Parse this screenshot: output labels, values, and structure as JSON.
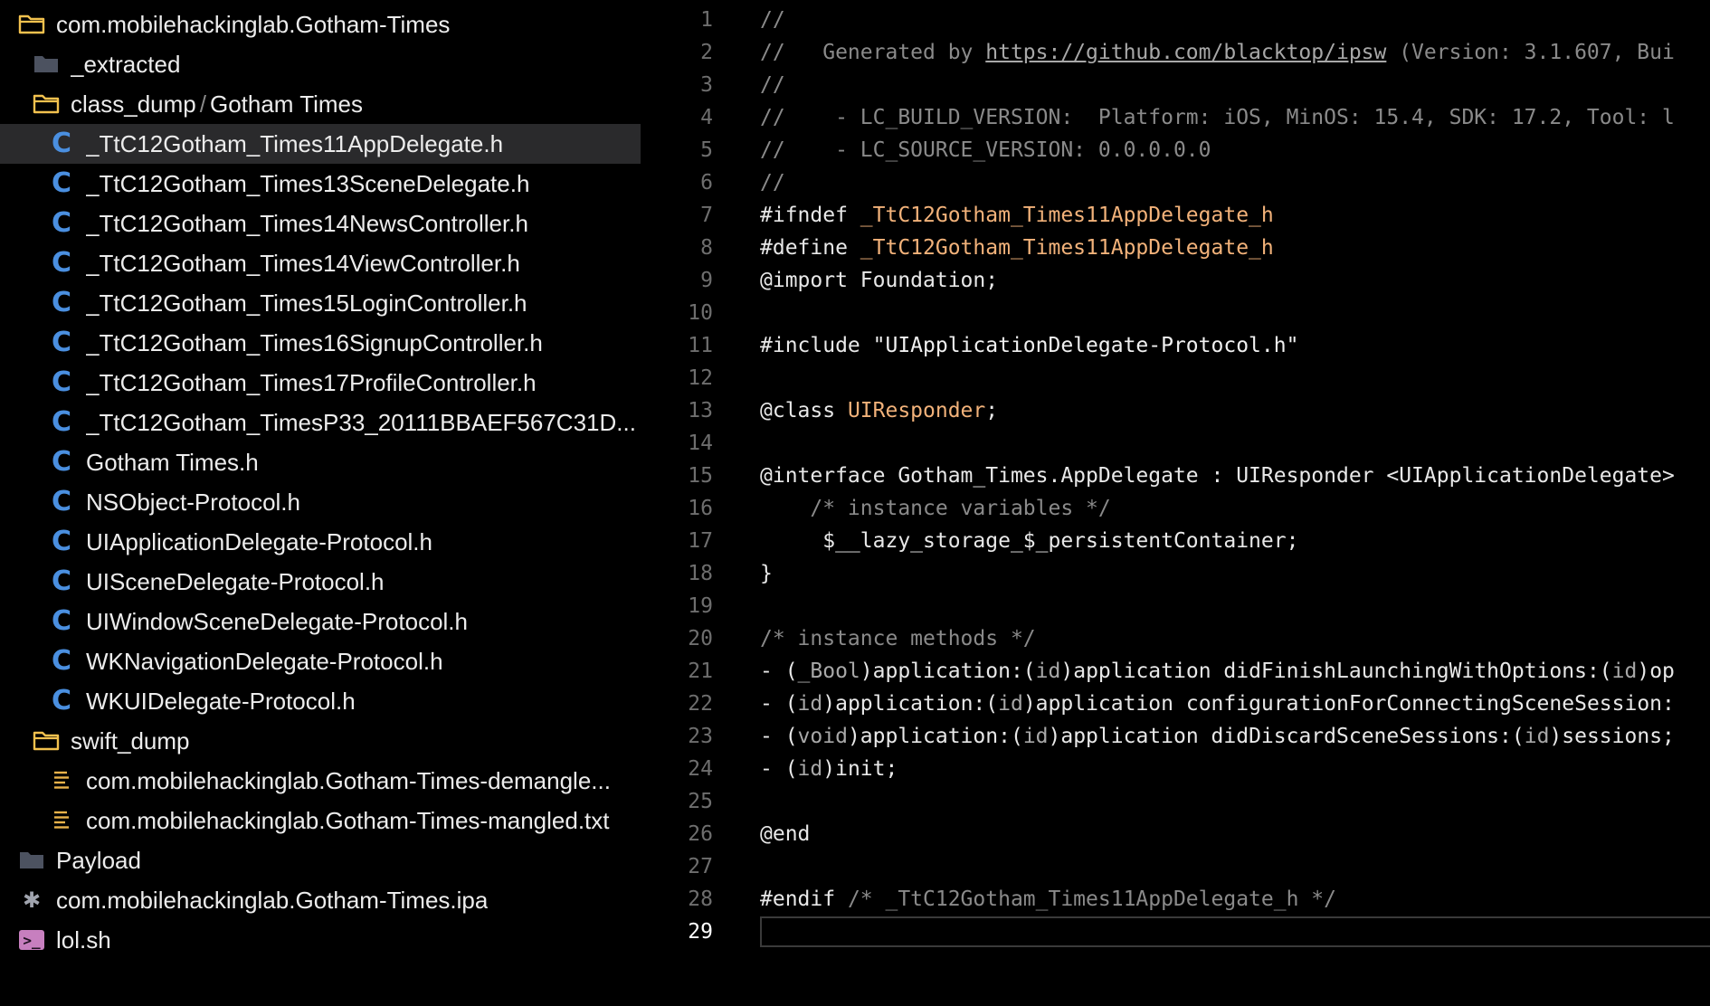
{
  "sidebar": {
    "items": [
      {
        "label": "com.mobilehackinglab.Gotham-Times",
        "icon": "folder-open-icon",
        "depth": 0
      },
      {
        "label": "_extracted",
        "icon": "folder-icon",
        "depth": 1
      },
      {
        "label": "class_dump",
        "label2": "Gotham Times",
        "sep": "/",
        "icon": "folder-open-icon",
        "depth": 1
      },
      {
        "label": "_TtC12Gotham_Times11AppDelegate.h",
        "icon": "c-file-icon",
        "depth": 2,
        "selected": true
      },
      {
        "label": "_TtC12Gotham_Times13SceneDelegate.h",
        "icon": "c-file-icon",
        "depth": 2
      },
      {
        "label": "_TtC12Gotham_Times14NewsController.h",
        "icon": "c-file-icon",
        "depth": 2
      },
      {
        "label": "_TtC12Gotham_Times14ViewController.h",
        "icon": "c-file-icon",
        "depth": 2
      },
      {
        "label": "_TtC12Gotham_Times15LoginController.h",
        "icon": "c-file-icon",
        "depth": 2
      },
      {
        "label": "_TtC12Gotham_Times16SignupController.h",
        "icon": "c-file-icon",
        "depth": 2
      },
      {
        "label": "_TtC12Gotham_Times17ProfileController.h",
        "icon": "c-file-icon",
        "depth": 2
      },
      {
        "label": "_TtC12Gotham_TimesP33_20111BBAEF567C31D...",
        "icon": "c-file-icon",
        "depth": 2
      },
      {
        "label": "Gotham Times.h",
        "icon": "c-file-icon",
        "depth": 2
      },
      {
        "label": "NSObject-Protocol.h",
        "icon": "c-file-icon",
        "depth": 2
      },
      {
        "label": "UIApplicationDelegate-Protocol.h",
        "icon": "c-file-icon",
        "depth": 2
      },
      {
        "label": "UISceneDelegate-Protocol.h",
        "icon": "c-file-icon",
        "depth": 2
      },
      {
        "label": "UIWindowSceneDelegate-Protocol.h",
        "icon": "c-file-icon",
        "depth": 2
      },
      {
        "label": "WKNavigationDelegate-Protocol.h",
        "icon": "c-file-icon",
        "depth": 2
      },
      {
        "label": "WKUIDelegate-Protocol.h",
        "icon": "c-file-icon",
        "depth": 2
      },
      {
        "label": "swift_dump",
        "icon": "folder-open-icon",
        "depth": 1
      },
      {
        "label": "com.mobilehackinglab.Gotham-Times-demangle...",
        "icon": "text-file-icon",
        "depth": 2
      },
      {
        "label": "com.mobilehackinglab.Gotham-Times-mangled.txt",
        "icon": "text-file-icon",
        "depth": 2
      },
      {
        "label": "Payload",
        "icon": "folder-icon",
        "depth": 0
      },
      {
        "label": "com.mobilehackinglab.Gotham-Times.ipa",
        "icon": "asterisk-icon",
        "depth": 0
      },
      {
        "label": "lol.sh",
        "icon": "terminal-icon",
        "depth": 0
      }
    ]
  },
  "editor": {
    "current_line": 29,
    "lines": [
      [
        {
          "t": "//",
          "c": "comment"
        }
      ],
      [
        {
          "t": "//   Generated by ",
          "c": "comment"
        },
        {
          "t": "https://github.com/blacktop/ipsw",
          "c": "link"
        },
        {
          "t": " (Version: 3.1.607, Bui",
          "c": "comment"
        }
      ],
      [
        {
          "t": "//",
          "c": "comment"
        }
      ],
      [
        {
          "t": "//    - LC_BUILD_VERSION:  Platform: iOS, MinOS: 15.4, SDK: 17.2, Tool: l",
          "c": "comment"
        }
      ],
      [
        {
          "t": "//    - LC_SOURCE_VERSION: 0.0.0.0.0",
          "c": "comment"
        }
      ],
      [
        {
          "t": "//",
          "c": "comment"
        }
      ],
      [
        {
          "t": "#ifndef ",
          "c": "plain"
        },
        {
          "t": "_TtC12Gotham_Times11AppDelegate_h",
          "c": "orange"
        }
      ],
      [
        {
          "t": "#define ",
          "c": "plain"
        },
        {
          "t": "_TtC12Gotham_Times11AppDelegate_h",
          "c": "orange"
        }
      ],
      [
        {
          "t": "@import Foundation;",
          "c": "plain"
        }
      ],
      [],
      [
        {
          "t": "#include ",
          "c": "plain"
        },
        {
          "t": "\"UIApplicationDelegate-Protocol.h\"",
          "c": "string"
        }
      ],
      [],
      [
        {
          "t": "@class ",
          "c": "plain"
        },
        {
          "t": "UIResponder",
          "c": "orange"
        },
        {
          "t": ";",
          "c": "plain"
        }
      ],
      [],
      [
        {
          "t": "@interface Gotham_Times.AppDelegate : UIResponder <UIApplicationDelegate>",
          "c": "plain"
        }
      ],
      [
        {
          "t": "    /* instance variables */",
          "c": "comment"
        }
      ],
      [
        {
          "t": "     $__lazy_storage_$_persistentContainer;",
          "c": "plain"
        }
      ],
      [
        {
          "t": "}",
          "c": "plain"
        }
      ],
      [],
      [
        {
          "t": "/* instance methods */",
          "c": "comment"
        }
      ],
      [
        {
          "t": "- (",
          "c": "plain"
        },
        {
          "t": "_Bool",
          "c": "dim"
        },
        {
          "t": ")application:(",
          "c": "plain"
        },
        {
          "t": "id",
          "c": "dim"
        },
        {
          "t": ")application didFinishLaunchingWithOptions:(",
          "c": "plain"
        },
        {
          "t": "id",
          "c": "dim"
        },
        {
          "t": ")op",
          "c": "plain"
        }
      ],
      [
        {
          "t": "- (",
          "c": "plain"
        },
        {
          "t": "id",
          "c": "dim"
        },
        {
          "t": ")application:(",
          "c": "plain"
        },
        {
          "t": "id",
          "c": "dim"
        },
        {
          "t": ")application configurationForConnectingSceneSession:",
          "c": "plain"
        }
      ],
      [
        {
          "t": "- (",
          "c": "plain"
        },
        {
          "t": "void",
          "c": "dim"
        },
        {
          "t": ")application:(",
          "c": "plain"
        },
        {
          "t": "id",
          "c": "dim"
        },
        {
          "t": ")application didDiscardSceneSessions:(",
          "c": "plain"
        },
        {
          "t": "id",
          "c": "dim"
        },
        {
          "t": ")sessions;",
          "c": "plain"
        }
      ],
      [
        {
          "t": "- (",
          "c": "plain"
        },
        {
          "t": "id",
          "c": "dim"
        },
        {
          "t": ")init;",
          "c": "plain"
        }
      ],
      [],
      [
        {
          "t": "@end",
          "c": "plain"
        }
      ],
      [],
      [
        {
          "t": "#endif ",
          "c": "plain"
        },
        {
          "t": "/* _TtC12Gotham_Times11AppDelegate_h */",
          "c": "comment"
        }
      ],
      []
    ]
  }
}
